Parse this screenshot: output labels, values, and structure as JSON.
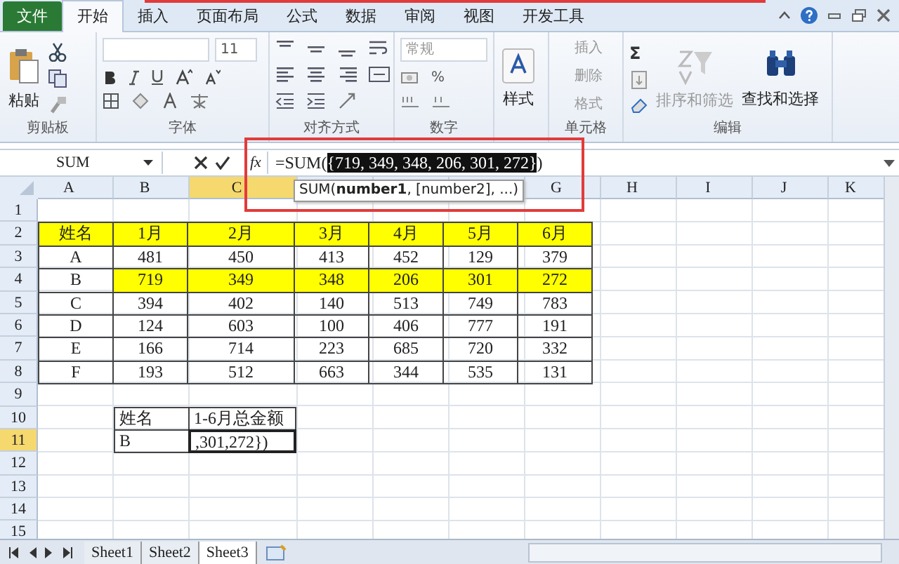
{
  "menu_tabs": [
    {
      "label": "文件",
      "kind": "file",
      "selected": false
    },
    {
      "label": "开始",
      "kind": "tab",
      "selected": true
    },
    {
      "label": "插入",
      "kind": "tab",
      "selected": false
    },
    {
      "label": "页面布局",
      "kind": "tab",
      "selected": false
    },
    {
      "label": "公式",
      "kind": "tab",
      "selected": false
    },
    {
      "label": "数据",
      "kind": "tab",
      "selected": false
    },
    {
      "label": "审阅",
      "kind": "tab",
      "selected": false
    },
    {
      "label": "视图",
      "kind": "tab",
      "selected": false
    },
    {
      "label": "开发工具",
      "kind": "tab",
      "selected": false
    }
  ],
  "ribbon": {
    "clipboard": {
      "label": "剪贴板",
      "paste": "粘贴"
    },
    "font": {
      "label": "字体",
      "font_size": "11"
    },
    "alignment": {
      "label": "对齐方式"
    },
    "number": {
      "label": "数字",
      "format": "常规",
      "percent": "%"
    },
    "styles": {
      "button": "样式"
    },
    "cells": {
      "label": "单元格",
      "buttons": [
        {
          "label": "插入",
          "disabled": true
        },
        {
          "label": "删除",
          "disabled": true
        },
        {
          "label": "格式",
          "disabled": true
        }
      ]
    },
    "editing": {
      "label": "编辑",
      "sum": "Σ",
      "buttons": [
        {
          "label": "排序和筛选",
          "disabled": true
        },
        {
          "label": "查找和选择",
          "disabled": false
        }
      ]
    }
  },
  "formula_bar": {
    "name_box": "SUM",
    "fx": "fx",
    "formula_start": "=SUM(",
    "formula_selected": "{719, 349, 348, 206, 301, 272}",
    "formula_end": ")",
    "tooltip": "SUM(**number1**, [number2], ...)"
  },
  "sheet": {
    "columns": [
      {
        "label": "A",
        "selected": false
      },
      {
        "label": "B",
        "selected": false
      },
      {
        "label": "C",
        "selected": true
      },
      {
        "selected": false
      },
      {
        "selected": false
      },
      {
        "selected": false
      },
      {
        "label": "G",
        "selected": false
      },
      {
        "label": "H",
        "selected": false
      },
      {
        "label": "I",
        "selected": false
      },
      {
        "label": "J",
        "selected": false
      },
      {
        "label": "K",
        "selected": false
      }
    ],
    "rows": [
      {
        "label": "1",
        "selected": false,
        "kind": "empty"
      },
      {
        "label": "2",
        "selected": false,
        "kind": "table",
        "cells": [
          {
            "text": "姓名",
            "highlighted": true
          },
          {
            "text": "1月",
            "highlighted": true
          },
          {
            "text": "2月",
            "highlighted": true
          },
          {
            "text": "3月",
            "highlighted": true
          },
          {
            "text": "4月",
            "highlighted": true
          },
          {
            "text": "5月",
            "highlighted": true
          },
          {
            "text": "6月",
            "highlighted": true
          }
        ]
      },
      {
        "label": "3",
        "selected": false,
        "kind": "table",
        "cells": [
          {
            "text": "A",
            "highlighted": false
          },
          {
            "text": "481",
            "highlighted": false
          },
          {
            "text": "450",
            "highlighted": false
          },
          {
            "text": "413",
            "highlighted": false
          },
          {
            "text": "452",
            "highlighted": false
          },
          {
            "text": "129",
            "highlighted": false
          },
          {
            "text": "379",
            "highlighted": false
          }
        ]
      },
      {
        "label": "4",
        "selected": false,
        "kind": "table",
        "cells": [
          {
            "text": "B",
            "highlighted": false
          },
          {
            "text": "719",
            "highlighted": true
          },
          {
            "text": "349",
            "highlighted": true
          },
          {
            "text": "348",
            "highlighted": true
          },
          {
            "text": "206",
            "highlighted": true
          },
          {
            "text": "301",
            "highlighted": true
          },
          {
            "text": "272",
            "highlighted": true
          }
        ]
      },
      {
        "label": "5",
        "selected": false,
        "kind": "table",
        "cells": [
          {
            "text": "C",
            "highlighted": false
          },
          {
            "text": "394",
            "highlighted": false
          },
          {
            "text": "402",
            "highlighted": false
          },
          {
            "text": "140",
            "highlighted": false
          },
          {
            "text": "513",
            "highlighted": false
          },
          {
            "text": "749",
            "highlighted": false
          },
          {
            "text": "783",
            "highlighted": false
          }
        ]
      },
      {
        "label": "6",
        "selected": false,
        "kind": "table",
        "cells": [
          {
            "text": "D",
            "highlighted": false
          },
          {
            "text": "124",
            "highlighted": false
          },
          {
            "text": "603",
            "highlighted": false
          },
          {
            "text": "100",
            "highlighted": false
          },
          {
            "text": "406",
            "highlighted": false
          },
          {
            "text": "777",
            "highlighted": false
          },
          {
            "text": "191",
            "highlighted": false
          }
        ]
      },
      {
        "label": "7",
        "selected": false,
        "kind": "table",
        "cells": [
          {
            "text": "E",
            "highlighted": false
          },
          {
            "text": "166",
            "highlighted": false
          },
          {
            "text": "714",
            "highlighted": false
          },
          {
            "text": "223",
            "highlighted": false
          },
          {
            "text": "685",
            "highlighted": false
          },
          {
            "text": "720",
            "highlighted": false
          },
          {
            "text": "332",
            "highlighted": false
          }
        ]
      },
      {
        "label": "8",
        "selected": false,
        "kind": "table",
        "cells": [
          {
            "text": "F",
            "highlighted": false
          },
          {
            "text": "193",
            "highlighted": false
          },
          {
            "text": "512",
            "highlighted": false
          },
          {
            "text": "663",
            "highlighted": false
          },
          {
            "text": "344",
            "highlighted": false
          },
          {
            "text": "535",
            "highlighted": false
          },
          {
            "text": "131",
            "highlighted": false
          }
        ]
      },
      {
        "label": "9",
        "selected": false,
        "kind": "empty"
      },
      {
        "label": "10",
        "selected": false,
        "kind": "summary",
        "cells": [
          {
            "text": "姓名"
          },
          {
            "text": "1-6月总金额"
          }
        ]
      },
      {
        "label": "11",
        "selected": true,
        "kind": "summary",
        "cells": [
          {
            "text": "B"
          },
          {
            "text": ",301,272})",
            "active": true
          }
        ]
      },
      {
        "label": "12",
        "selected": false,
        "kind": "empty"
      },
      {
        "label": "13",
        "selected": false,
        "kind": "empty"
      },
      {
        "label": "14",
        "selected": false,
        "kind": "empty"
      },
      {
        "label": "15",
        "selected": false,
        "kind": "empty"
      }
    ]
  },
  "sheet_tabs": [
    {
      "label": "Sheet1",
      "selected": false
    },
    {
      "label": "Sheet2",
      "selected": false
    },
    {
      "label": "Sheet3",
      "selected": true
    }
  ]
}
